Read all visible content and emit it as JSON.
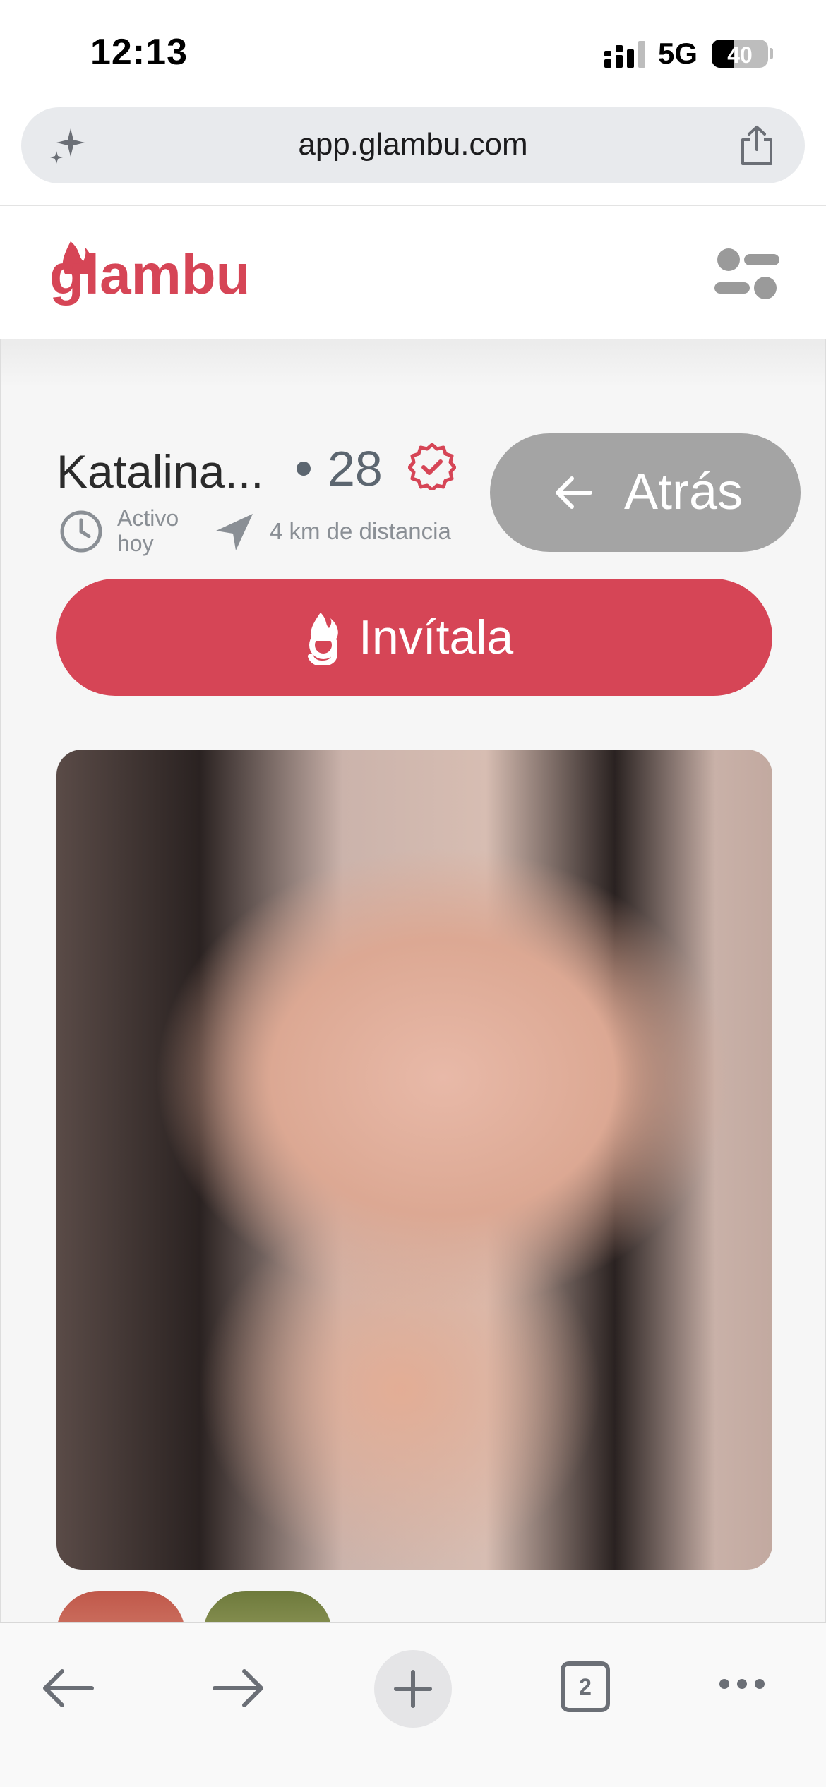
{
  "status_bar": {
    "time": "12:13",
    "network": "5G",
    "battery": "40",
    "battery_level": 0.4
  },
  "browser": {
    "url": "app.glambu.com",
    "tab_count": "2"
  },
  "app": {
    "logo_text": "glambu",
    "brand_color": "#d64556"
  },
  "profile": {
    "name": "Katalina...",
    "age": "28",
    "status_line1": "Activo",
    "status_line2": "hoy",
    "distance": "4  km de distancia"
  },
  "buttons": {
    "back_label": "Atrás",
    "invite_label": "Invítala"
  },
  "icons": {
    "ai": "sparkle-icon",
    "share": "share-icon",
    "menu": "menu-icon",
    "verified": "verified-icon",
    "clock": "clock-icon",
    "navigation": "navigation-icon",
    "back": "arrow-left-icon",
    "flame": "flame-icon"
  }
}
